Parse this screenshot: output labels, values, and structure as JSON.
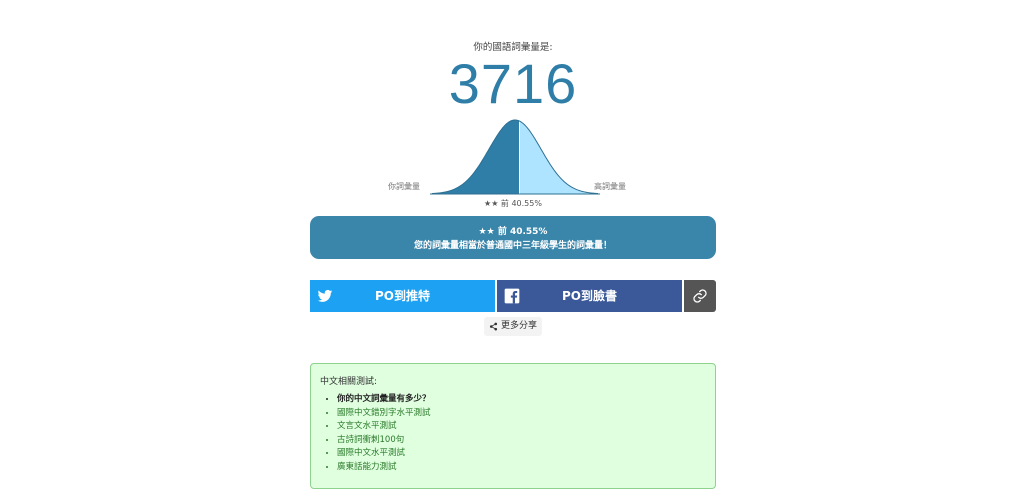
{
  "result": {
    "subtitle": "你的國語詞彙量是:",
    "score": "3716",
    "curve_left_label": "你詞彙量",
    "curve_right_label": "高詞彙量",
    "curve_caption": "★★ 前 40.55%",
    "percentile": 40.55,
    "box_line1": "★★ 前 40.55%",
    "box_line2": "您的詞彙量相當於普通國中三年級學生的詞彙量！"
  },
  "share": {
    "twitter_label": "PO到推特",
    "facebook_label": "PO到臉書",
    "link_icon": "link-icon",
    "more_label": "更多分享"
  },
  "related": {
    "heading": "中文相關測試:",
    "items": [
      "你的中文詞彙量有多少？",
      "國際中文錯別字水平測試",
      "文言文水平測試",
      "古詩詞衝刺100句",
      "國際中文水平測試",
      "廣東話能力測試"
    ]
  },
  "colors": {
    "primary": "#3a85aa",
    "curve_dark": "#2e7ea8",
    "curve_light": "#aee4ff",
    "twitter": "#1da1f2",
    "facebook": "#3b5998",
    "link_button": "#555555",
    "related_bg": "#dfffdf"
  }
}
